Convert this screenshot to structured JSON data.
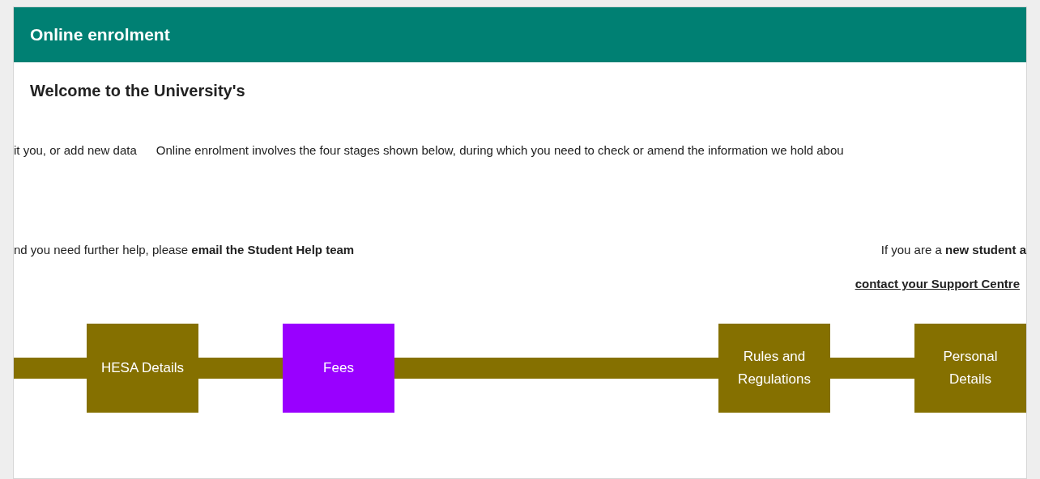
{
  "panel": {
    "title": "Online enrolment"
  },
  "welcome": "Welcome to the University's",
  "intro": [
    {
      "text": "it you, or add new data"
    },
    {
      "text": "Online enrolment involves the four stages shown below, during which you need to check or amend the information we hold abou"
    }
  ],
  "help": [
    {
      "text": "nd you need further help, please **email the Student Help team**"
    },
    {
      "text": "If you are a **new student a**"
    }
  ],
  "support": "contact your Support Centre",
  "stages": [
    {
      "label": "HESA Details",
      "selected": false
    },
    {
      "label": "Fees",
      "selected": true
    },
    {
      "label": "Rules and Regulations",
      "selected": false
    },
    {
      "label": "Personal Details",
      "selected": false
    }
  ]
}
